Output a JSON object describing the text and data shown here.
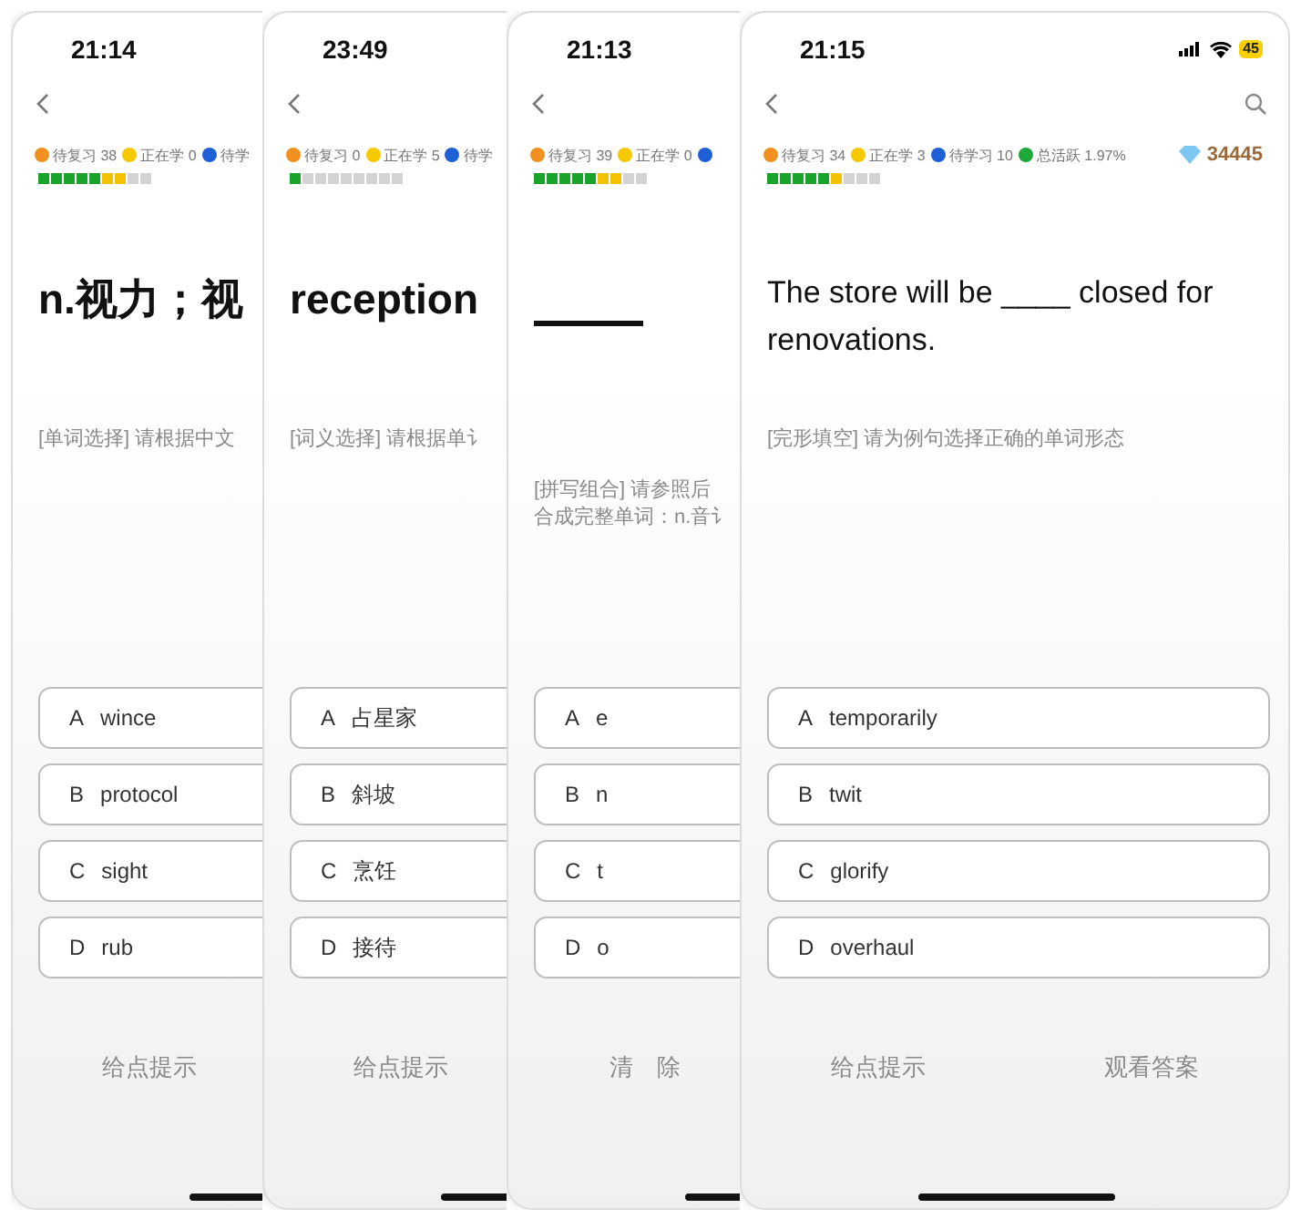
{
  "screens": [
    {
      "time": "21:14",
      "stats": [
        {
          "label": "待复习 38",
          "color": "#f0901e"
        },
        {
          "label": "正在学 0",
          "color": "#f5c800"
        },
        {
          "label": "待学",
          "color": "#1f5fd6"
        }
      ],
      "progress": [
        {
          "color": "#1aa32a"
        },
        {
          "color": "#1aa32a"
        },
        {
          "color": "#1aa32a"
        },
        {
          "color": "#1aa32a"
        },
        {
          "color": "#1aa32a"
        },
        {
          "color": "#f2c200"
        },
        {
          "color": "#f2c200"
        },
        {
          "color": "#d4d4d4"
        },
        {
          "color": "#d4d4d4"
        }
      ],
      "question": {
        "kind": "word",
        "text": "n.视力；视"
      },
      "prompt": [
        "[单词选择] 请根据中文"
      ],
      "options": [
        {
          "letter": "A",
          "text": "wince"
        },
        {
          "letter": "B",
          "text": "protocol"
        },
        {
          "letter": "C",
          "text": "sight"
        },
        {
          "letter": "D",
          "text": "rub"
        }
      ],
      "actions": [
        "给点提示"
      ]
    },
    {
      "time": "23:49",
      "stats": [
        {
          "label": "待复习 0",
          "color": "#f0901e"
        },
        {
          "label": "正在学 5",
          "color": "#f5c800"
        },
        {
          "label": "待学",
          "color": "#1f5fd6"
        }
      ],
      "progress": [
        {
          "color": "#1aa32a"
        },
        {
          "color": "#d4d4d4"
        },
        {
          "color": "#d4d4d4"
        },
        {
          "color": "#d4d4d4"
        },
        {
          "color": "#d4d4d4"
        },
        {
          "color": "#d4d4d4"
        },
        {
          "color": "#d4d4d4"
        },
        {
          "color": "#d4d4d4"
        },
        {
          "color": "#d4d4d4"
        }
      ],
      "question": {
        "kind": "word",
        "text": "reception"
      },
      "prompt": [
        "[词义选择] 请根据单讠"
      ],
      "options": [
        {
          "letter": "A",
          "text": "占星家"
        },
        {
          "letter": "B",
          "text": "斜坡"
        },
        {
          "letter": "C",
          "text": "烹饪"
        },
        {
          "letter": "D",
          "text": "接待"
        }
      ],
      "actions": [
        "给点提示"
      ]
    },
    {
      "time": "21:13",
      "stats": [
        {
          "label": "待复习 39",
          "color": "#f0901e"
        },
        {
          "label": "正在学 0",
          "color": "#f5c800"
        },
        {
          "color": "#1f5fd6"
        }
      ],
      "progress": [
        {
          "color": "#1aa32a"
        },
        {
          "color": "#1aa32a"
        },
        {
          "color": "#1aa32a"
        },
        {
          "color": "#1aa32a"
        },
        {
          "color": "#1aa32a"
        },
        {
          "color": "#f2c200"
        },
        {
          "color": "#f2c200"
        },
        {
          "color": "#d4d4d4"
        },
        {
          "color": "#d4d4d4"
        }
      ],
      "question": {
        "kind": "blank"
      },
      "prompt": [
        "[拼写组合] 请参照后",
        "合成完整单词：n.音讠"
      ],
      "options": [
        {
          "letter": "A",
          "text": "e"
        },
        {
          "letter": "B",
          "text": "n"
        },
        {
          "letter": "C",
          "text": "t"
        },
        {
          "letter": "D",
          "text": "o"
        }
      ],
      "actions": [
        "清　除"
      ]
    },
    {
      "time": "21:15",
      "battery": "45",
      "search": true,
      "stats": [
        {
          "label": "待复习 34",
          "color": "#f0901e"
        },
        {
          "label": "正在学 3",
          "color": "#f5c800"
        },
        {
          "label": "待学习 10",
          "color": "#1f5fd6"
        },
        {
          "label": "总活跃 1.97%",
          "color": "#1fa83a"
        }
      ],
      "gems": "34445",
      "progress": [
        {
          "color": "#1aa32a"
        },
        {
          "color": "#1aa32a"
        },
        {
          "color": "#1aa32a"
        },
        {
          "color": "#1aa32a"
        },
        {
          "color": "#1aa32a"
        },
        {
          "color": "#f2c200"
        },
        {
          "color": "#d4d4d4"
        },
        {
          "color": "#d4d4d4"
        },
        {
          "color": "#d4d4d4"
        }
      ],
      "question": {
        "kind": "sentence",
        "text": "The store will be ____ closed for renovations."
      },
      "prompt": [
        "[完形填空] 请为例句选择正确的单词形态"
      ],
      "options": [
        {
          "letter": "A",
          "text": "temporarily"
        },
        {
          "letter": "B",
          "text": "twit"
        },
        {
          "letter": "C",
          "text": "glorify"
        },
        {
          "letter": "D",
          "text": "overhaul"
        }
      ],
      "actions": [
        "给点提示",
        "观看答案"
      ]
    }
  ]
}
